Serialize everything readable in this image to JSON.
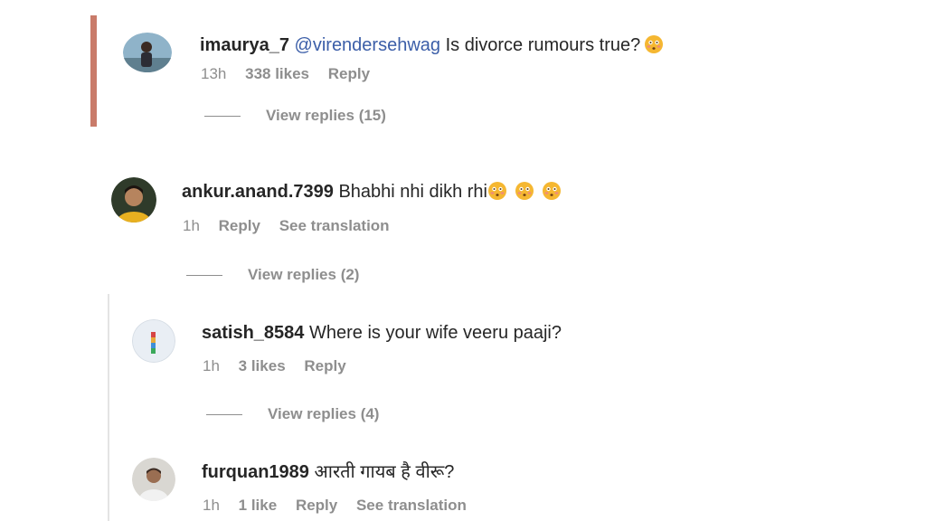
{
  "comments": [
    {
      "username": "imaurya_7",
      "mention": "@virendersehwag",
      "text": "Is divorce rumours true?",
      "emoji_count": 1,
      "time": "13h",
      "likes": "338 likes",
      "reply": "Reply",
      "view_replies": "View replies (15)"
    },
    {
      "username": "ankur.anand.7399",
      "text": "Bhabhi nhi dikh rhi",
      "emoji_count": 3,
      "time": "1h",
      "reply": "Reply",
      "translation": "See translation",
      "view_replies": "View replies (2)"
    },
    {
      "username": "satish_8584",
      "text": "Where is your wife veeru paaji?",
      "time": "1h",
      "likes": "3 likes",
      "reply": "Reply",
      "view_replies": "View replies (4)"
    },
    {
      "username": "furquan1989",
      "text": "आरती गायब है वीरू?",
      "time": "1h",
      "likes": "1 like",
      "reply": "Reply",
      "translation": "See translation"
    }
  ],
  "colors": {
    "accent_bar": "#c97b6a",
    "mention": "#3b5ea8",
    "meta": "#8e8e8e"
  },
  "icons": {
    "emoji": "flushed-face-icon"
  }
}
